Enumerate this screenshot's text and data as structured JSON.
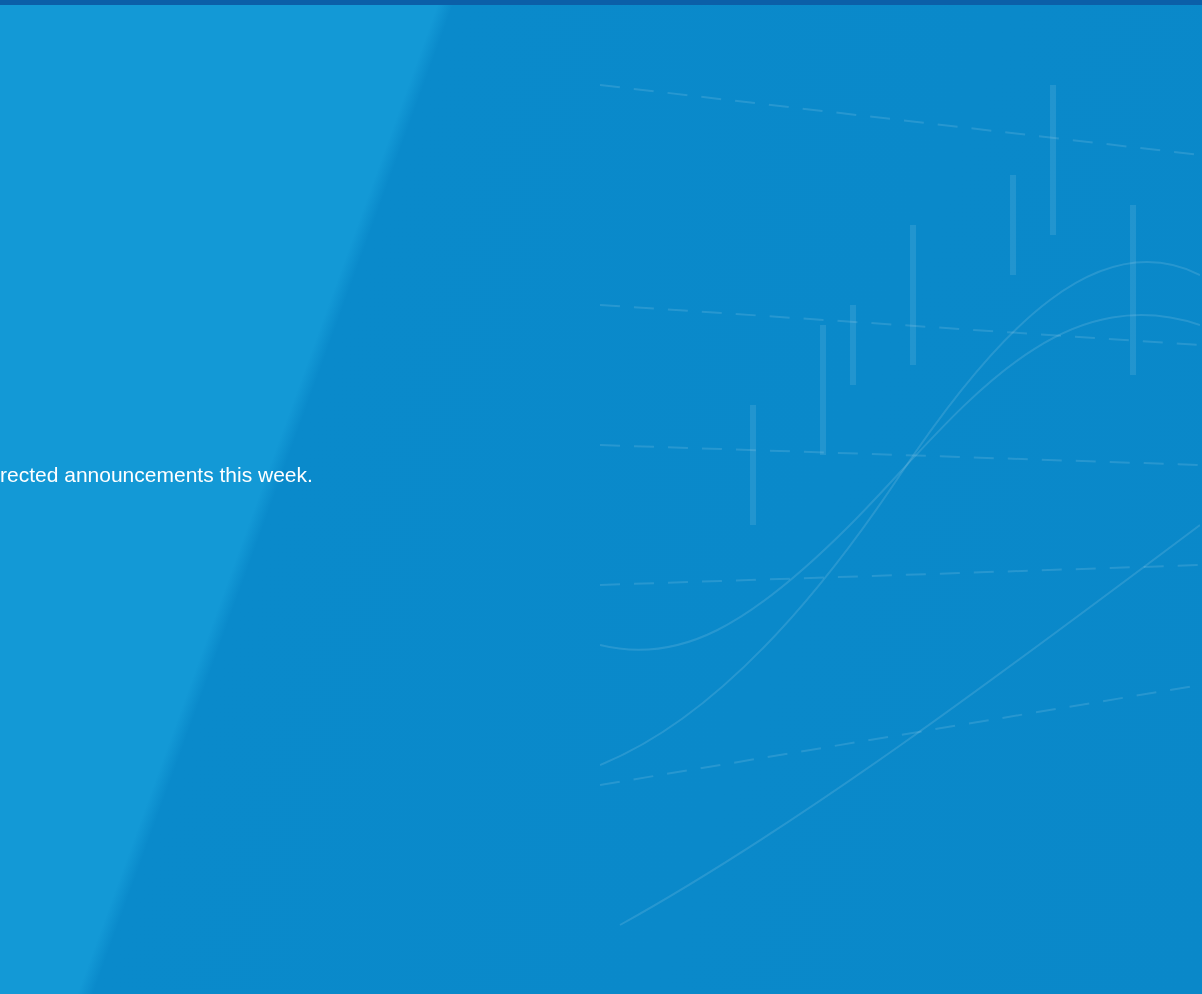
{
  "hero": {
    "text": "rected announcements this week."
  }
}
